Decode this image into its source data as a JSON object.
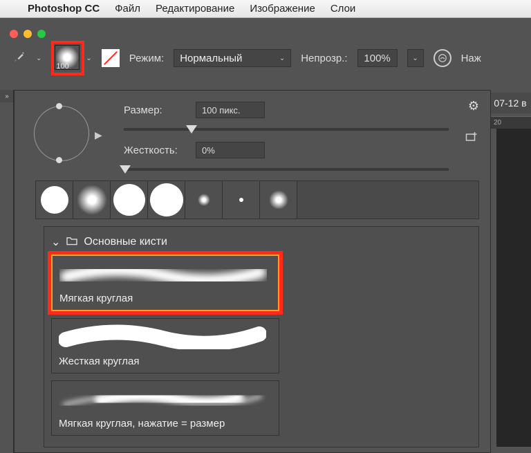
{
  "menubar": {
    "app": "Photoshop CC",
    "items": [
      "Файл",
      "Редактирование",
      "Изображение",
      "Слои"
    ]
  },
  "doc": {
    "title_fragment": "07-12 в",
    "ruler_tick": "20"
  },
  "options": {
    "preset_size": "100",
    "mode_label": "Режим:",
    "mode_value": "Нормальный",
    "opacity_label": "Непрозр.:",
    "opacity_value": "100%",
    "flow_label_fragment": "Наж"
  },
  "panel": {
    "size_label": "Размер:",
    "size_value": "100 пикс.",
    "hardness_label": "Жесткость:",
    "hardness_value": "0%"
  },
  "folder": {
    "name": "Основные кисти"
  },
  "brushes": [
    {
      "name": "Мягкая круглая"
    },
    {
      "name": "Жесткая круглая"
    },
    {
      "name": "Мягкая круглая, нажатие = размер"
    }
  ]
}
